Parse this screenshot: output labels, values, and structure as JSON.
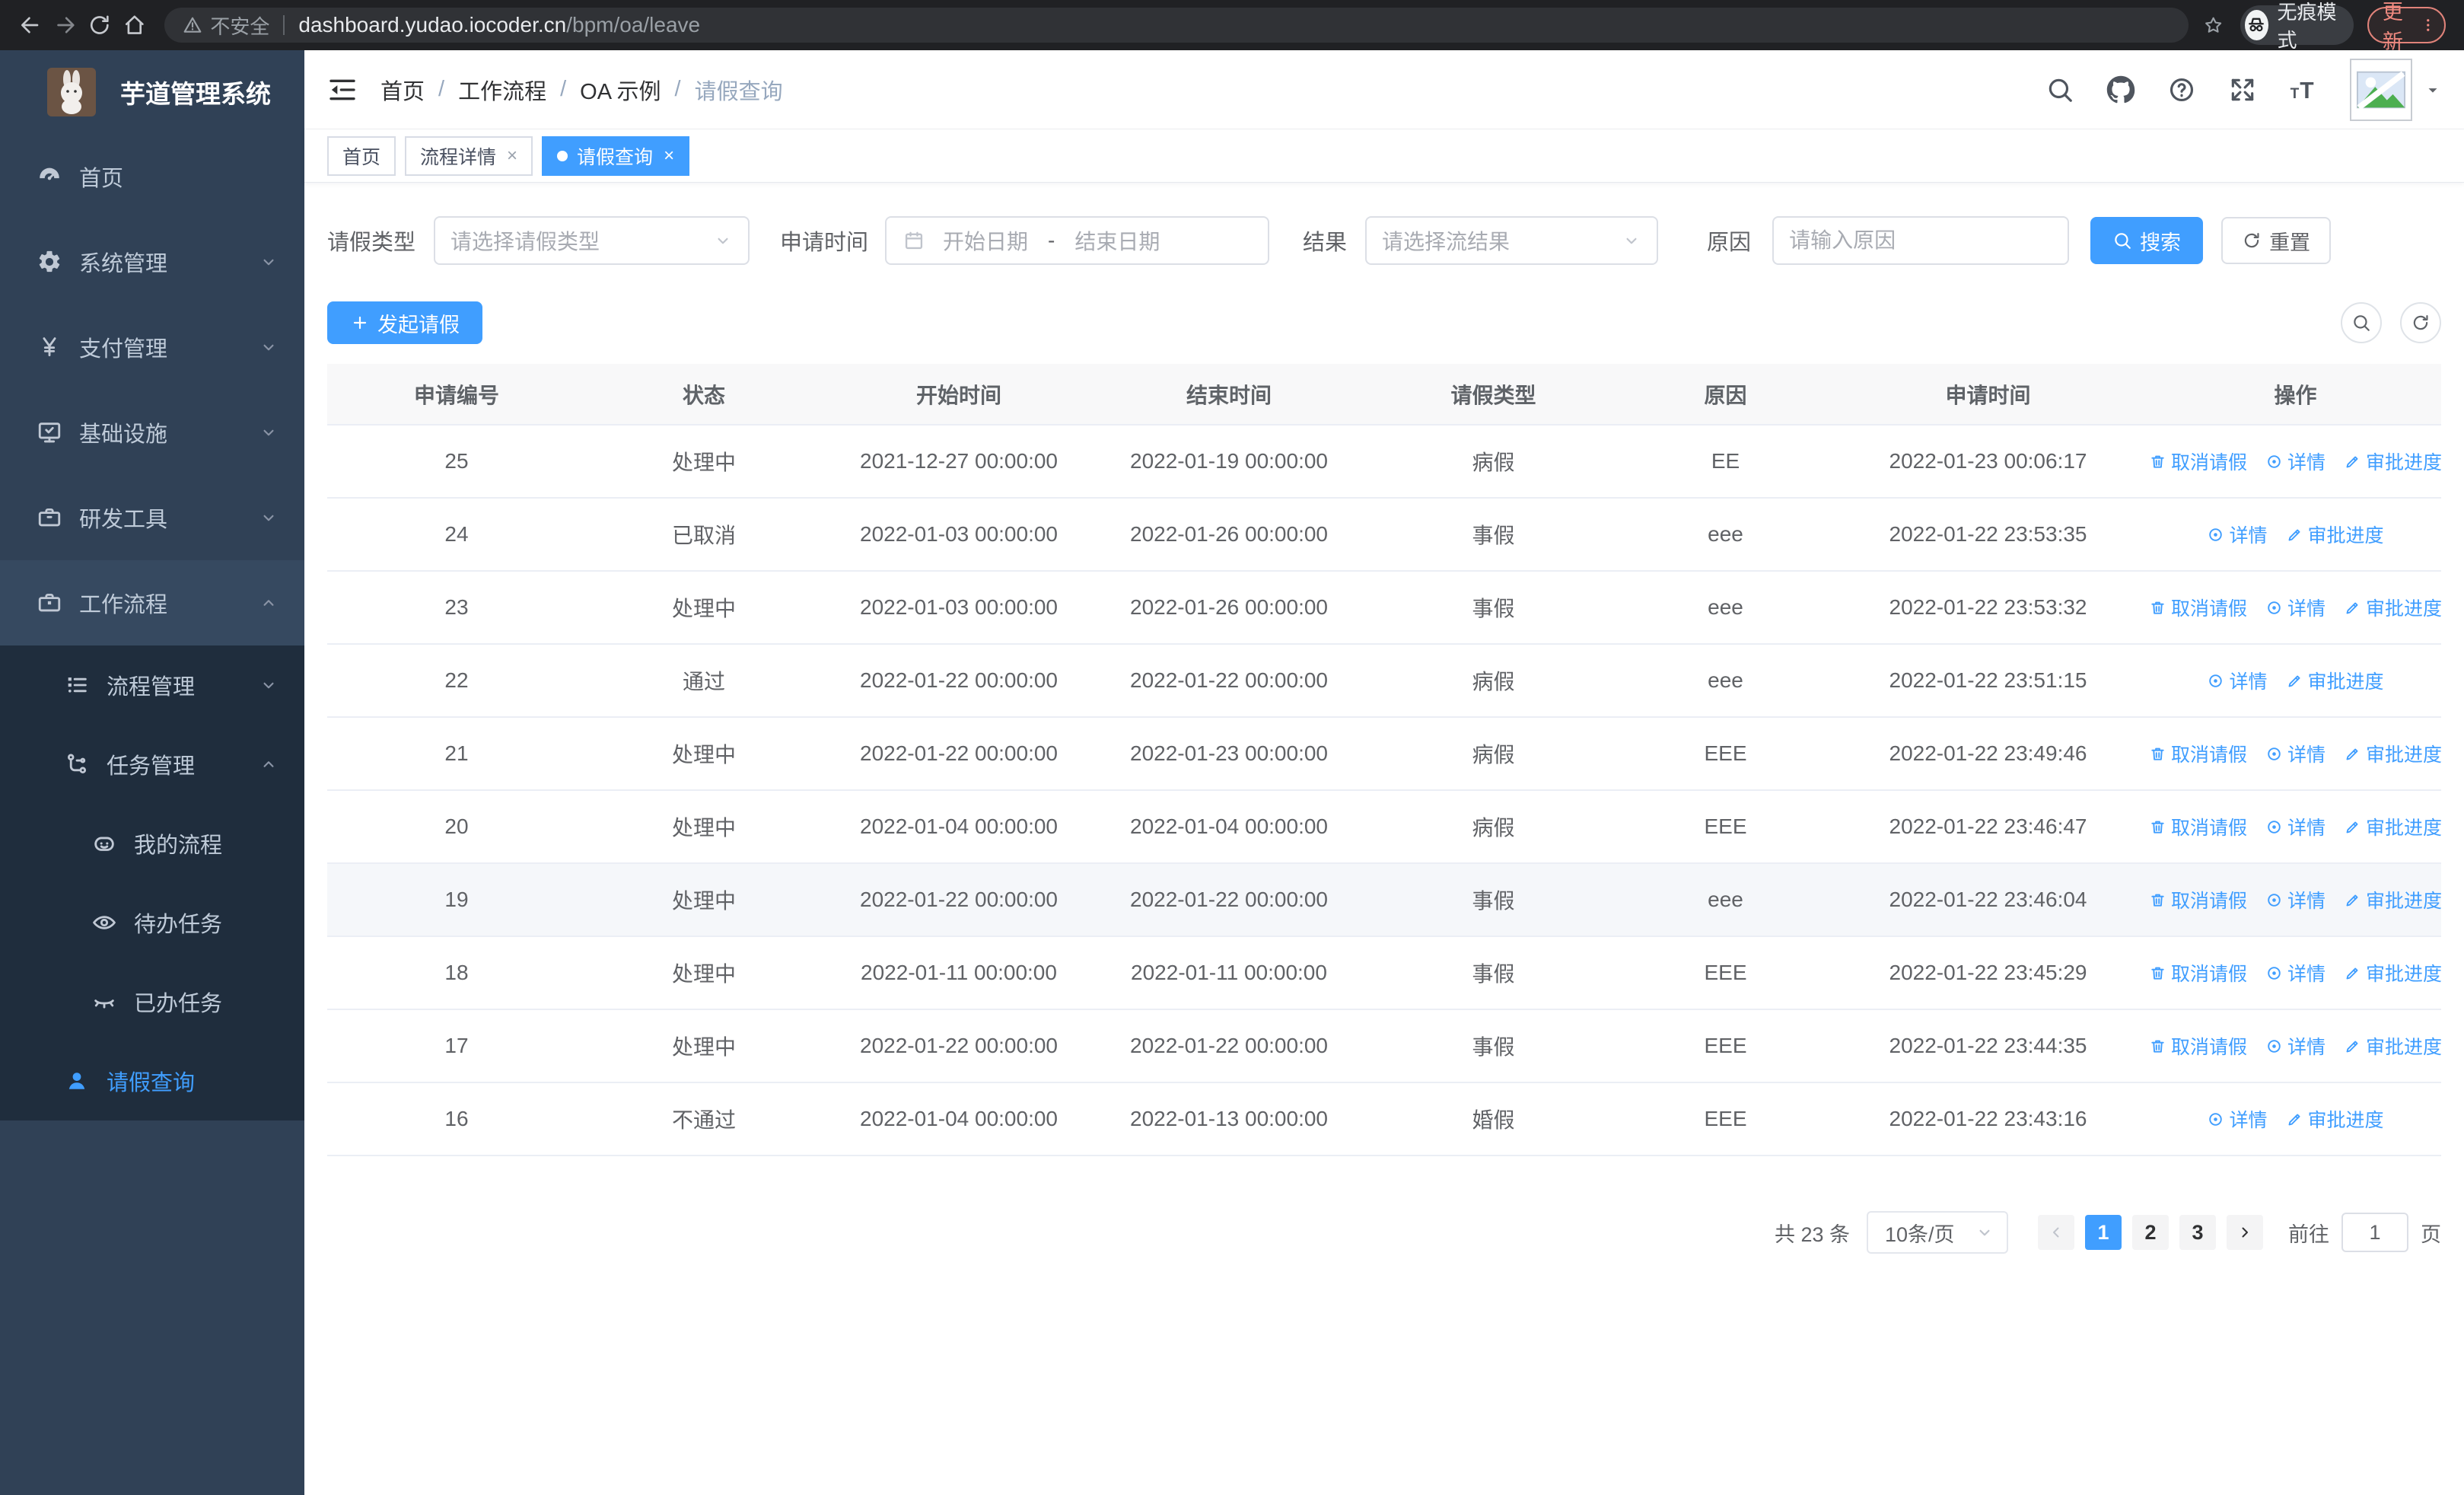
{
  "colors": {
    "accent": "#409eff",
    "sidebar_bg": "#304156",
    "submenu_bg": "#1f2d3d",
    "update_chip": "#f08a80"
  },
  "browser": {
    "security_label": "不安全",
    "url_host": "dashboard.yudao.iocoder.cn",
    "url_path": "/bpm/oa/leave",
    "incognito_label": "无痕模式",
    "update_label": "更新"
  },
  "sidebar": {
    "title": "芋道管理系统",
    "items": [
      {
        "key": "home",
        "label": "首页",
        "icon": "dashboard-icon",
        "level": 0,
        "chevron": null
      },
      {
        "key": "system",
        "label": "系统管理",
        "icon": "gear-icon",
        "level": 0,
        "chevron": "down"
      },
      {
        "key": "payment",
        "label": "支付管理",
        "icon": "yen-icon",
        "level": 0,
        "chevron": "down"
      },
      {
        "key": "infra",
        "label": "基础设施",
        "icon": "monitor-icon",
        "level": 0,
        "chevron": "down"
      },
      {
        "key": "devtools",
        "label": "研发工具",
        "icon": "toolbox-icon",
        "level": 0,
        "chevron": "down"
      },
      {
        "key": "workflow",
        "label": "工作流程",
        "icon": "briefcase-icon",
        "level": 0,
        "chevron": "up",
        "open": true
      },
      {
        "key": "process-mgmt",
        "label": "流程管理",
        "icon": "list-tree-icon",
        "level": 1,
        "chevron": "down",
        "submenu": true
      },
      {
        "key": "task-mgmt",
        "label": "任务管理",
        "icon": "flow-icon",
        "level": 1,
        "chevron": "up",
        "submenu": true
      },
      {
        "key": "my-process",
        "label": "我的流程",
        "icon": "robot-icon",
        "level": 2,
        "submenu": true
      },
      {
        "key": "todo-tasks",
        "label": "待办任务",
        "icon": "eye-icon",
        "level": 2,
        "submenu": true
      },
      {
        "key": "done-tasks",
        "label": "已办任务",
        "icon": "eye-closed-icon",
        "level": 2,
        "submenu": true
      },
      {
        "key": "leave-query",
        "label": "请假查询",
        "icon": "user-icon",
        "level": 1,
        "submenu": true,
        "active": true
      }
    ]
  },
  "header": {
    "breadcrumbs": [
      "首页",
      "工作流程",
      "OA 示例",
      "请假查询"
    ],
    "breadcrumb_separator": "/",
    "right_icons": [
      "search-icon",
      "github-icon",
      "question-icon",
      "fullscreen-icon",
      "fontsize-icon"
    ]
  },
  "tabs": [
    {
      "key": "home",
      "label": "首页",
      "closable": false,
      "active": false
    },
    {
      "key": "process-detail",
      "label": "流程详情",
      "closable": true,
      "active": false
    },
    {
      "key": "leave-query",
      "label": "请假查询",
      "closable": true,
      "active": true
    }
  ],
  "filters": {
    "leave_type_label": "请假类型",
    "leave_type_placeholder": "请选择请假类型",
    "apply_time_label": "申请时间",
    "start_date_placeholder": "开始日期",
    "range_separator": "-",
    "end_date_placeholder": "结束日期",
    "result_label": "结果",
    "result_placeholder": "请选择流结果",
    "reason_label": "原因",
    "reason_placeholder": "请输入原因",
    "search_label": "搜索",
    "reset_label": "重置"
  },
  "toolbar": {
    "create_label": "发起请假"
  },
  "table": {
    "columns": [
      "申请编号",
      "状态",
      "开始时间",
      "结束时间",
      "请假类型",
      "原因",
      "申请时间",
      "操作"
    ],
    "action_labels": {
      "cancel": "取消请假",
      "detail": "详情",
      "progress": "审批进度"
    },
    "action_icons": {
      "cancel": "trash-icon",
      "detail": "view-icon",
      "progress": "pen-icon"
    },
    "rows": [
      {
        "id": "25",
        "status": "处理中",
        "start": "2021-12-27 00:00:00",
        "end": "2022-01-19 00:00:00",
        "type": "病假",
        "reason": "EE",
        "apply_time": "2022-01-23 00:06:17",
        "actions": [
          "cancel",
          "detail",
          "progress"
        ]
      },
      {
        "id": "24",
        "status": "已取消",
        "start": "2022-01-03 00:00:00",
        "end": "2022-01-26 00:00:00",
        "type": "事假",
        "reason": "eee",
        "apply_time": "2022-01-22 23:53:35",
        "actions": [
          "detail",
          "progress"
        ]
      },
      {
        "id": "23",
        "status": "处理中",
        "start": "2022-01-03 00:00:00",
        "end": "2022-01-26 00:00:00",
        "type": "事假",
        "reason": "eee",
        "apply_time": "2022-01-22 23:53:32",
        "actions": [
          "cancel",
          "detail",
          "progress"
        ]
      },
      {
        "id": "22",
        "status": "通过",
        "start": "2022-01-22 00:00:00",
        "end": "2022-01-22 00:00:00",
        "type": "病假",
        "reason": "eee",
        "apply_time": "2022-01-22 23:51:15",
        "actions": [
          "detail",
          "progress"
        ]
      },
      {
        "id": "21",
        "status": "处理中",
        "start": "2022-01-22 00:00:00",
        "end": "2022-01-23 00:00:00",
        "type": "病假",
        "reason": "EEE",
        "apply_time": "2022-01-22 23:49:46",
        "actions": [
          "cancel",
          "detail",
          "progress"
        ]
      },
      {
        "id": "20",
        "status": "处理中",
        "start": "2022-01-04 00:00:00",
        "end": "2022-01-04 00:00:00",
        "type": "病假",
        "reason": "EEE",
        "apply_time": "2022-01-22 23:46:47",
        "actions": [
          "cancel",
          "detail",
          "progress"
        ]
      },
      {
        "id": "19",
        "status": "处理中",
        "start": "2022-01-22 00:00:00",
        "end": "2022-01-22 00:00:00",
        "type": "事假",
        "reason": "eee",
        "apply_time": "2022-01-22 23:46:04",
        "actions": [
          "cancel",
          "detail",
          "progress"
        ],
        "highlight": true
      },
      {
        "id": "18",
        "status": "处理中",
        "start": "2022-01-11 00:00:00",
        "end": "2022-01-11 00:00:00",
        "type": "事假",
        "reason": "EEE",
        "apply_time": "2022-01-22 23:45:29",
        "actions": [
          "cancel",
          "detail",
          "progress"
        ]
      },
      {
        "id": "17",
        "status": "处理中",
        "start": "2022-01-22 00:00:00",
        "end": "2022-01-22 00:00:00",
        "type": "事假",
        "reason": "EEE",
        "apply_time": "2022-01-22 23:44:35",
        "actions": [
          "cancel",
          "detail",
          "progress"
        ]
      },
      {
        "id": "16",
        "status": "不通过",
        "start": "2022-01-04 00:00:00",
        "end": "2022-01-13 00:00:00",
        "type": "婚假",
        "reason": "EEE",
        "apply_time": "2022-01-22 23:43:16",
        "actions": [
          "detail",
          "progress"
        ]
      }
    ]
  },
  "pagination": {
    "total_label": "共 23 条",
    "page_size": "10条/页",
    "pages": [
      "1",
      "2",
      "3"
    ],
    "active_page": "1",
    "goto_label": "前往",
    "goto_value": "1",
    "page_suffix": "页"
  }
}
